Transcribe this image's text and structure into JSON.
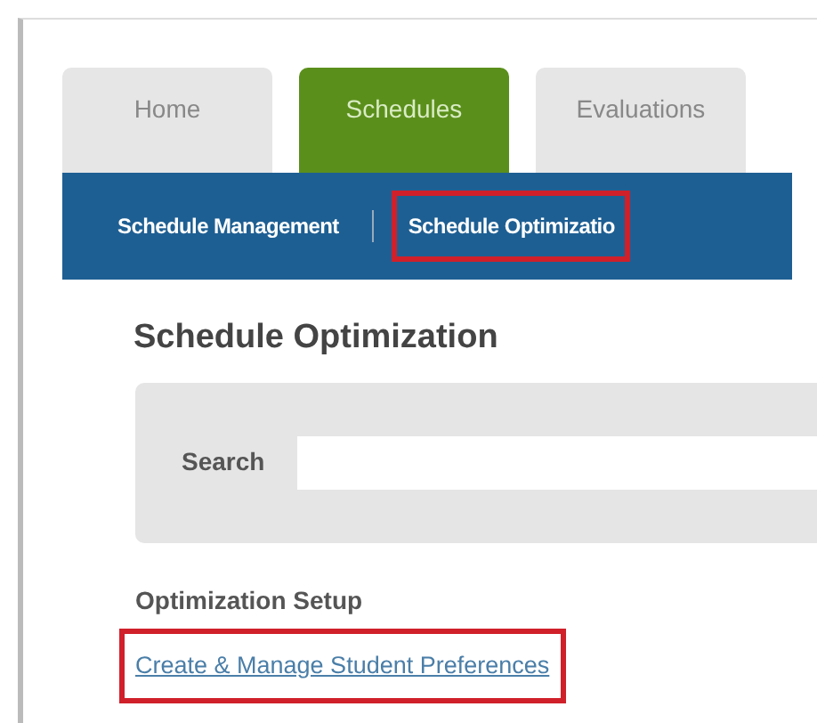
{
  "tabs": [
    {
      "label": "Home",
      "selected": false
    },
    {
      "label": "Schedules",
      "selected": true
    },
    {
      "label": "Evaluations",
      "selected": false
    }
  ],
  "subnav": [
    {
      "label": "Schedule Management",
      "highlighted": false
    },
    {
      "label": "Schedule Optimizatio",
      "highlighted": true
    }
  ],
  "page_title": "Schedule Optimization",
  "search": {
    "label": "Search"
  },
  "section": {
    "heading": "Optimization Setup",
    "links": [
      {
        "label": "Create & Manage Student Preferences",
        "highlighted": true
      }
    ]
  }
}
